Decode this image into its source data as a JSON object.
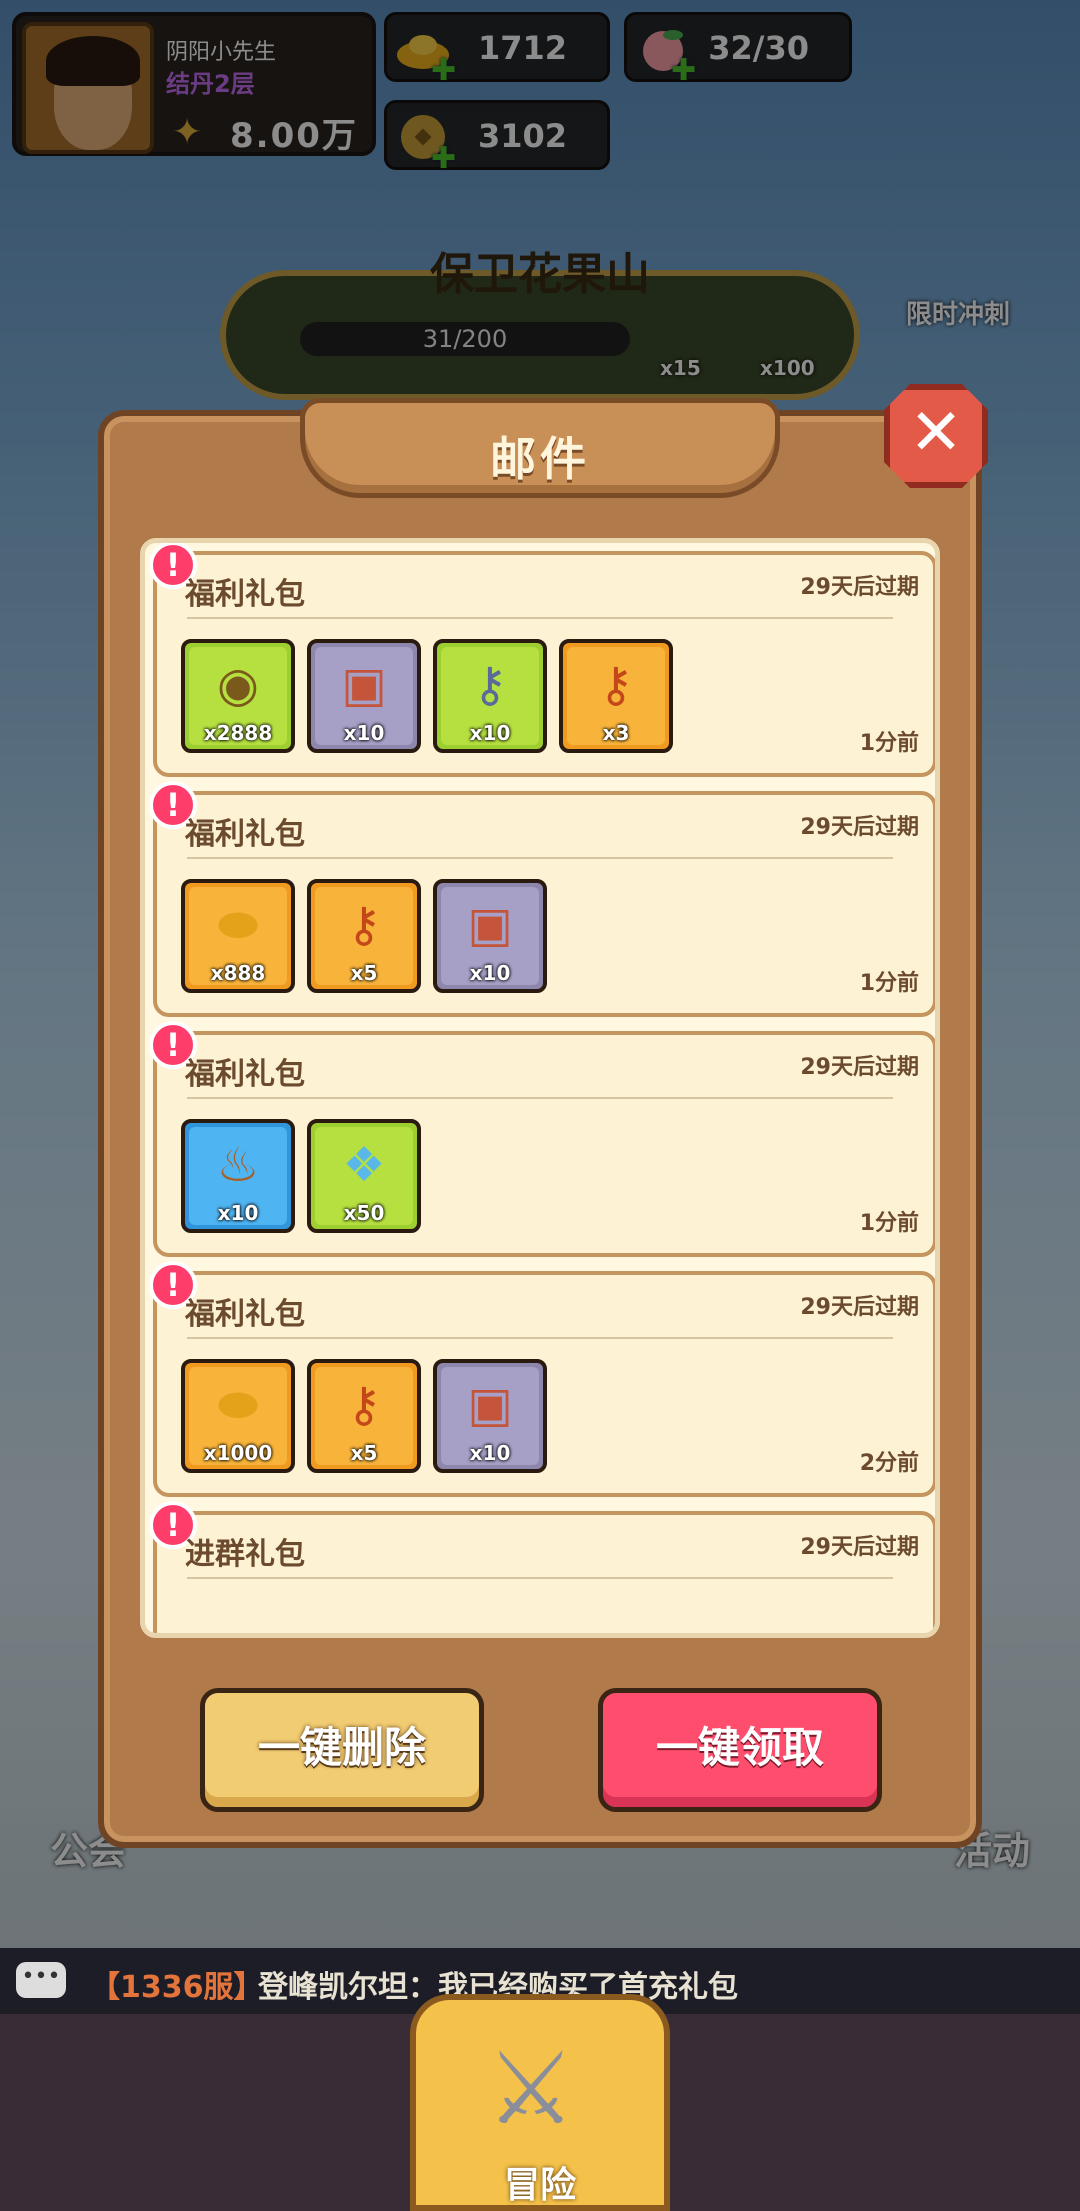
{
  "hud": {
    "player_name": "阴阳小先生",
    "player_rank": "结丹2层",
    "player_power": "8.00万",
    "gold": "1712",
    "peach": "32/30",
    "coin": "3102"
  },
  "event": {
    "title": "保卫花果山",
    "progress": "31/200",
    "reward_1": "x15",
    "reward_2": "x100"
  },
  "side": {
    "limited_sprint": "限时冲刺",
    "guild": "公会",
    "activity": "活动"
  },
  "mail_modal": {
    "title": "邮件",
    "mails": [
      {
        "title": "福利礼包",
        "expire": "29天后过期",
        "time": "1分前",
        "items": [
          {
            "icon": "coin-icon",
            "qty": "x2888",
            "rarity": "green"
          },
          {
            "icon": "treasure-chest-icon",
            "qty": "x10",
            "rarity": "purple"
          },
          {
            "icon": "silver-key-icon",
            "qty": "x10",
            "rarity": "green"
          },
          {
            "icon": "gold-key-icon",
            "qty": "x3",
            "rarity": "orange"
          }
        ]
      },
      {
        "title": "福利礼包",
        "expire": "29天后过期",
        "time": "1分前",
        "items": [
          {
            "icon": "gold-ingot-icon",
            "qty": "x888",
            "rarity": "orange"
          },
          {
            "icon": "gold-key-icon",
            "qty": "x5",
            "rarity": "orange"
          },
          {
            "icon": "treasure-chest-icon",
            "qty": "x10",
            "rarity": "purple"
          }
        ]
      },
      {
        "title": "福利礼包",
        "expire": "29天后过期",
        "time": "1分前",
        "items": [
          {
            "icon": "gourd-scroll-icon",
            "qty": "x10",
            "rarity": "blue"
          },
          {
            "icon": "crystal-icon",
            "qty": "x50",
            "rarity": "green"
          }
        ]
      },
      {
        "title": "福利礼包",
        "expire": "29天后过期",
        "time": "2分前",
        "items": [
          {
            "icon": "gold-ingot-icon",
            "qty": "x1000",
            "rarity": "orange"
          },
          {
            "icon": "gold-key-icon",
            "qty": "x5",
            "rarity": "orange"
          },
          {
            "icon": "treasure-chest-icon",
            "qty": "x10",
            "rarity": "purple"
          }
        ]
      },
      {
        "title": "进群礼包",
        "expire": "29天后过期",
        "time": "",
        "items": []
      }
    ],
    "delete_all": "一键删除",
    "claim_all": "一键领取"
  },
  "chat": {
    "server": "【1336服】",
    "message": "登峰凯尔坦：我已经购买了首充礼包"
  },
  "nav": {
    "adventure": "冒险"
  },
  "colors": {
    "claim_button": "#ff4d6d",
    "delete_button": "#f2cc72",
    "badge": "#ff3d6a",
    "modal_frame": "#b07a4a"
  }
}
